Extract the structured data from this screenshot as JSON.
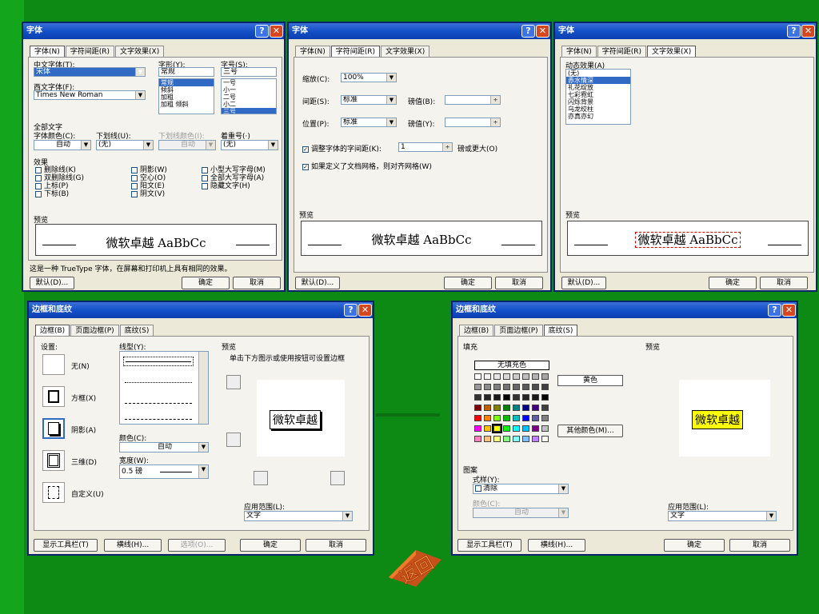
{
  "font": {
    "title": "字体",
    "tabs": [
      "字体(N)",
      "字符间距(R)",
      "文字效果(X)"
    ],
    "cn_label": "中文字体(T):",
    "cn_value": "宋体",
    "style_label": "字形(Y):",
    "style_value": "常规",
    "size_label": "字号(S):",
    "size_value": "三号",
    "styles": [
      "常规",
      "倾斜",
      "加粗",
      "加粗 倾斜"
    ],
    "sizes": [
      "一号",
      "小一",
      "二号",
      "小二",
      "三号"
    ],
    "west_label": "西文字体(F):",
    "west_value": "Times New Roman",
    "all_text": "全部文字",
    "color_label": "字体颜色(C):",
    "color_value": "自动",
    "underline_label": "下划线(U):",
    "underline_value": "(无)",
    "ucolor_label": "下划线颜色(I):",
    "ucolor_value": "自动",
    "emph_label": "着重号(·)",
    "emph_value": "(无)",
    "effects_label": "效果",
    "effects": [
      "删除线(K)",
      "双删除线(G)",
      "上标(P)",
      "下标(B)",
      "阴影(W)",
      "空心(O)",
      "阳文(E)",
      "阴文(V)",
      "小型大写字母(M)",
      "全部大写字母(A)",
      "隐藏文字(H)"
    ],
    "preview_label": "预览",
    "preview_text": "微软卓越 AaBbCc",
    "note": "这是一种 TrueType 字体，在屏幕和打印机上具有相同的效果。",
    "default": "默认(D)...",
    "ok": "确定",
    "cancel": "取消"
  },
  "spacing": {
    "title": "字体",
    "tabs": [
      "字体(N)",
      "字符间距(R)",
      "文字效果(X)"
    ],
    "scale_label": "缩放(C):",
    "scale_value": "100%",
    "space_label": "间距(S):",
    "space_value": "标准",
    "space_by": "磅值(B):",
    "pos_label": "位置(P):",
    "pos_value": "标准",
    "pos_by": "磅值(Y):",
    "kern_label": "调整字体的字间距(K):",
    "kern_value": "1",
    "kern_suffix": "磅或更大(O)",
    "grid_label": "如果定义了文档网格，则对齐网格(W)",
    "preview_label": "预览",
    "preview_text": "微软卓越 AaBbCc",
    "default": "默认(D)...",
    "ok": "确定",
    "cancel": "取消"
  },
  "effects": {
    "title": "字体",
    "tabs": [
      "字体(N)",
      "字符间距(R)",
      "文字效果(X)"
    ],
    "anim_label": "动态效果(A)",
    "anim": [
      "(无)",
      "赤水情深",
      "礼花绽放",
      "七彩霓虹",
      "闪烁背景",
      "乌龙绞柱",
      "亦真亦幻"
    ],
    "preview_label": "预览",
    "preview_text": "微软卓越 AaBbCc",
    "default": "默认(D)...",
    "ok": "确定",
    "cancel": "取消"
  },
  "border": {
    "title": "边框和底纹",
    "tabs": [
      "边框(B)",
      "页面边框(P)",
      "底纹(S)"
    ],
    "setting_label": "设置:",
    "settings": [
      "无(N)",
      "方框(X)",
      "阴影(A)",
      "三维(D)",
      "自定义(U)"
    ],
    "style_label": "线型(Y):",
    "color_label": "颜色(C):",
    "color_value": "自动",
    "width_label": "宽度(W):",
    "width_value": "0.5 磅",
    "preview_label": "预览",
    "preview_hint": "单击下方图示或使用按钮可设置边框",
    "preview_text": "微软卓越",
    "apply_label": "应用范围(L):",
    "apply_value": "文字",
    "toolbar": "显示工具栏(T)",
    "hline": "横线(H)...",
    "options": "选项(O)...",
    "ok": "确定",
    "cancel": "取消"
  },
  "shading": {
    "title": "边框和底纹",
    "tabs": [
      "边框(B)",
      "页面边框(P)",
      "底纹(S)"
    ],
    "fill_label": "填充",
    "no_fill": "无填充色",
    "selected_color": "黄色",
    "more_colors": "其他颜色(M)...",
    "pattern_label": "图案",
    "style_label": "式样(Y):",
    "style_value": "清除",
    "color_label": "颜色(C):",
    "color_value": "自动",
    "preview_label": "预览",
    "preview_text": "微软卓越",
    "apply_label": "应用范围(L):",
    "apply_value": "文字",
    "toolbar": "显示工具栏(T)",
    "hline": "横线(H)...",
    "ok": "确定",
    "cancel": "取消",
    "highlight": "#ffff00"
  },
  "return_label": "返回"
}
